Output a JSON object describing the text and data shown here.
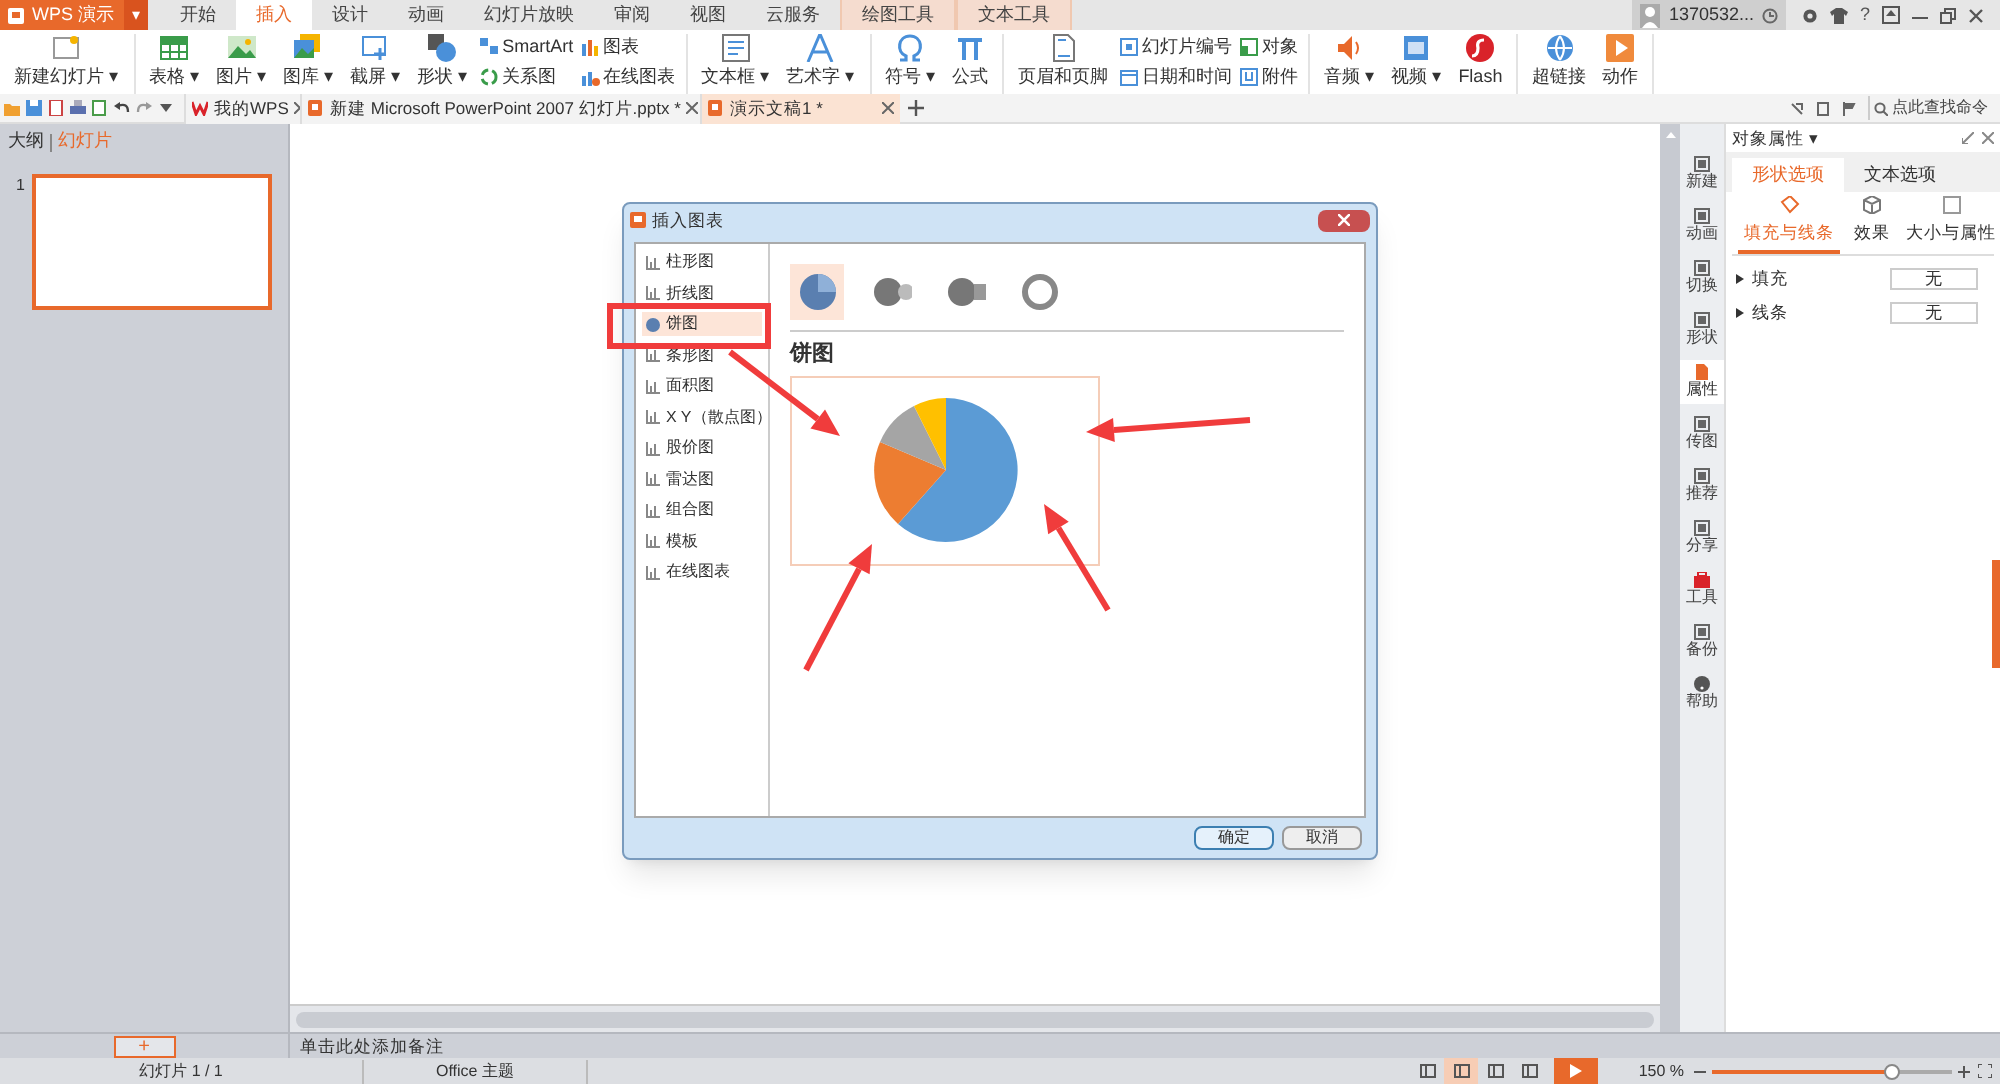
{
  "app_button": {
    "label": "WPS 演示",
    "caret": "▾"
  },
  "menu_tabs": [
    {
      "label": "开始",
      "selected": false,
      "contextual": false
    },
    {
      "label": "插入",
      "selected": true,
      "contextual": false
    },
    {
      "label": "设计",
      "selected": false,
      "contextual": false
    },
    {
      "label": "动画",
      "selected": false,
      "contextual": false
    },
    {
      "label": "幻灯片放映",
      "selected": false,
      "contextual": false
    },
    {
      "label": "审阅",
      "selected": false,
      "contextual": false
    },
    {
      "label": "视图",
      "selected": false,
      "contextual": false
    },
    {
      "label": "云服务",
      "selected": false,
      "contextual": false
    },
    {
      "label": "绘图工具",
      "selected": false,
      "contextual": true
    },
    {
      "label": "文本工具",
      "selected": false,
      "contextual": true
    }
  ],
  "account": {
    "user": "1370532...",
    "help": "?"
  },
  "ribbon": {
    "groups": [
      {
        "items": [
          {
            "label": "新建幻灯片 ▾",
            "kind": "large"
          }
        ]
      },
      {
        "items": [
          {
            "label": "表格 ▾",
            "kind": "large"
          },
          {
            "label": "图片 ▾",
            "kind": "large"
          },
          {
            "label": "图库 ▾",
            "kind": "large"
          },
          {
            "label": "截屏 ▾",
            "kind": "large"
          },
          {
            "label": "形状 ▾",
            "kind": "large"
          },
          {
            "label": "SmartArt",
            "kind": "small"
          },
          {
            "label": "关系图",
            "kind": "small"
          },
          {
            "label": "图表",
            "kind": "small"
          },
          {
            "label": "在线图表",
            "kind": "small"
          }
        ]
      },
      {
        "items": [
          {
            "label": "文本框 ▾",
            "kind": "large"
          },
          {
            "label": "艺术字 ▾",
            "kind": "large"
          }
        ]
      },
      {
        "items": [
          {
            "label": "符号 ▾",
            "kind": "large"
          },
          {
            "label": "公式",
            "kind": "large"
          }
        ]
      },
      {
        "items": [
          {
            "label": "页眉和页脚",
            "kind": "large"
          },
          {
            "label": "幻灯片编号",
            "kind": "small"
          },
          {
            "label": "日期和时间",
            "kind": "small"
          },
          {
            "label": "对象",
            "kind": "small"
          },
          {
            "label": "附件",
            "kind": "small"
          }
        ]
      },
      {
        "items": [
          {
            "label": "音频 ▾",
            "kind": "large"
          },
          {
            "label": "视频 ▾",
            "kind": "large"
          },
          {
            "label": "Flash",
            "kind": "large"
          }
        ]
      },
      {
        "items": [
          {
            "label": "超链接",
            "kind": "large"
          },
          {
            "label": "动作",
            "kind": "large"
          }
        ]
      }
    ]
  },
  "doc_tabs": [
    {
      "label": "我的WPS",
      "selected": false
    },
    {
      "label": "新建 Microsoft PowerPoint 2007 幻灯片.pptx *",
      "selected": false
    },
    {
      "label": "演示文稿1 *",
      "selected": true
    }
  ],
  "command_search": {
    "placeholder": "点此查找命令"
  },
  "left_pane": {
    "tabs": [
      {
        "label": "大纲",
        "selected": false
      },
      {
        "label": "幻灯片",
        "selected": true
      }
    ],
    "slides": [
      {
        "number": "1",
        "selected": true
      }
    ],
    "add_button": "+"
  },
  "dialog": {
    "title": "插入图表",
    "chart_types": [
      {
        "label": "柱形图",
        "selected": false
      },
      {
        "label": "折线图",
        "selected": false
      },
      {
        "label": "饼图",
        "selected": true
      },
      {
        "label": "条形图",
        "selected": false
      },
      {
        "label": "面积图",
        "selected": false
      },
      {
        "label": "X Y（散点图）",
        "selected": false
      },
      {
        "label": "股价图",
        "selected": false
      },
      {
        "label": "雷达图",
        "selected": false
      },
      {
        "label": "组合图",
        "selected": false
      },
      {
        "label": "模板",
        "selected": false
      },
      {
        "label": "在线图表",
        "selected": false
      }
    ],
    "subtypes": [
      {
        "selected": true
      },
      {
        "selected": false
      },
      {
        "selected": false
      },
      {
        "selected": false
      }
    ],
    "heading": "饼图",
    "buttons": [
      {
        "label": "确定",
        "primary": true
      },
      {
        "label": "取消",
        "primary": false
      }
    ]
  },
  "notes": {
    "placeholder": "单击此处添加备注"
  },
  "side_bar": [
    {
      "label": "新建",
      "selected": false
    },
    {
      "label": "动画",
      "selected": false
    },
    {
      "label": "切换",
      "selected": false
    },
    {
      "label": "形状",
      "selected": false
    },
    {
      "label": "属性",
      "selected": true
    },
    {
      "label": "传图",
      "selected": false
    },
    {
      "label": "推荐",
      "selected": false
    },
    {
      "label": "分享",
      "selected": false
    },
    {
      "label": "工具",
      "selected": false
    },
    {
      "label": "备份",
      "selected": false
    },
    {
      "label": "帮助",
      "selected": false
    }
  ],
  "properties": {
    "title": "对象属性 ▾",
    "tabs": [
      {
        "label": "形状选项",
        "selected": true
      },
      {
        "label": "文本选项",
        "selected": false
      }
    ],
    "subtabs": [
      {
        "label": "填充与线条",
        "selected": true
      },
      {
        "label": "效果",
        "selected": false
      },
      {
        "label": "大小与属性",
        "selected": false
      }
    ],
    "rows": [
      {
        "label": "填充",
        "value": "无"
      },
      {
        "label": "线条",
        "value": "无"
      }
    ]
  },
  "status_bar": {
    "slide": "幻灯片 1 / 1",
    "theme": "Office 主题",
    "zoom": "150 %",
    "zoom_slider": {
      "level": 0.75
    }
  }
}
